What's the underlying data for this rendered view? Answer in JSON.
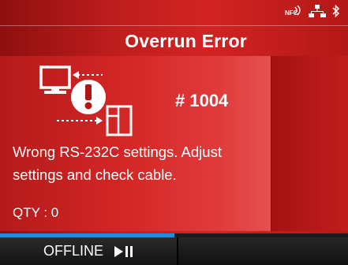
{
  "status_icons": [
    "nfc-icon",
    "network-icon",
    "bluetooth-icon"
  ],
  "status_labels": {
    "nfc": "NFC"
  },
  "title": "Overrun Error",
  "error": {
    "icon": "computer-printer-error-icon",
    "code": "# 1004",
    "message_line1": "Wrong RS-232C settings. Adjust",
    "message_line2": "settings and check cable."
  },
  "qty": {
    "text": "QTY : 0"
  },
  "bottom": {
    "offline_label": "OFFLINE",
    "play_pause_icon": "play-pause-icon",
    "progress_fraction": 0.5
  },
  "colors": {
    "background_red": "#c11e1e",
    "progress_blue": "#1e8fe0",
    "text": "#ffffff"
  }
}
